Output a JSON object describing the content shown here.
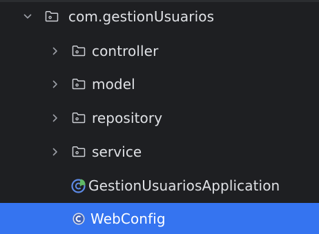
{
  "project_tree": {
    "package": {
      "label": "com.gestionUsuarios",
      "icon": "package-folder-icon",
      "expanded": true
    },
    "folders": [
      {
        "label": "controller",
        "icon": "package-folder-icon",
        "expanded": false
      },
      {
        "label": "model",
        "icon": "package-folder-icon",
        "expanded": false
      },
      {
        "label": "repository",
        "icon": "package-folder-icon",
        "expanded": false
      },
      {
        "label": "service",
        "icon": "package-folder-icon",
        "expanded": false
      }
    ],
    "files": [
      {
        "label": "GestionUsuariosApplication",
        "icon": "spring-boot-class-icon",
        "selected": false
      },
      {
        "label": "WebConfig",
        "icon": "java-class-icon",
        "selected": true
      }
    ]
  },
  "colors": {
    "background": "#1e1f22",
    "selection": "#3574f0",
    "text": "#dfe1e5",
    "chevron": "#9da0a8",
    "class_badge": "#5d8ae6",
    "spring_green": "#5fb865"
  }
}
